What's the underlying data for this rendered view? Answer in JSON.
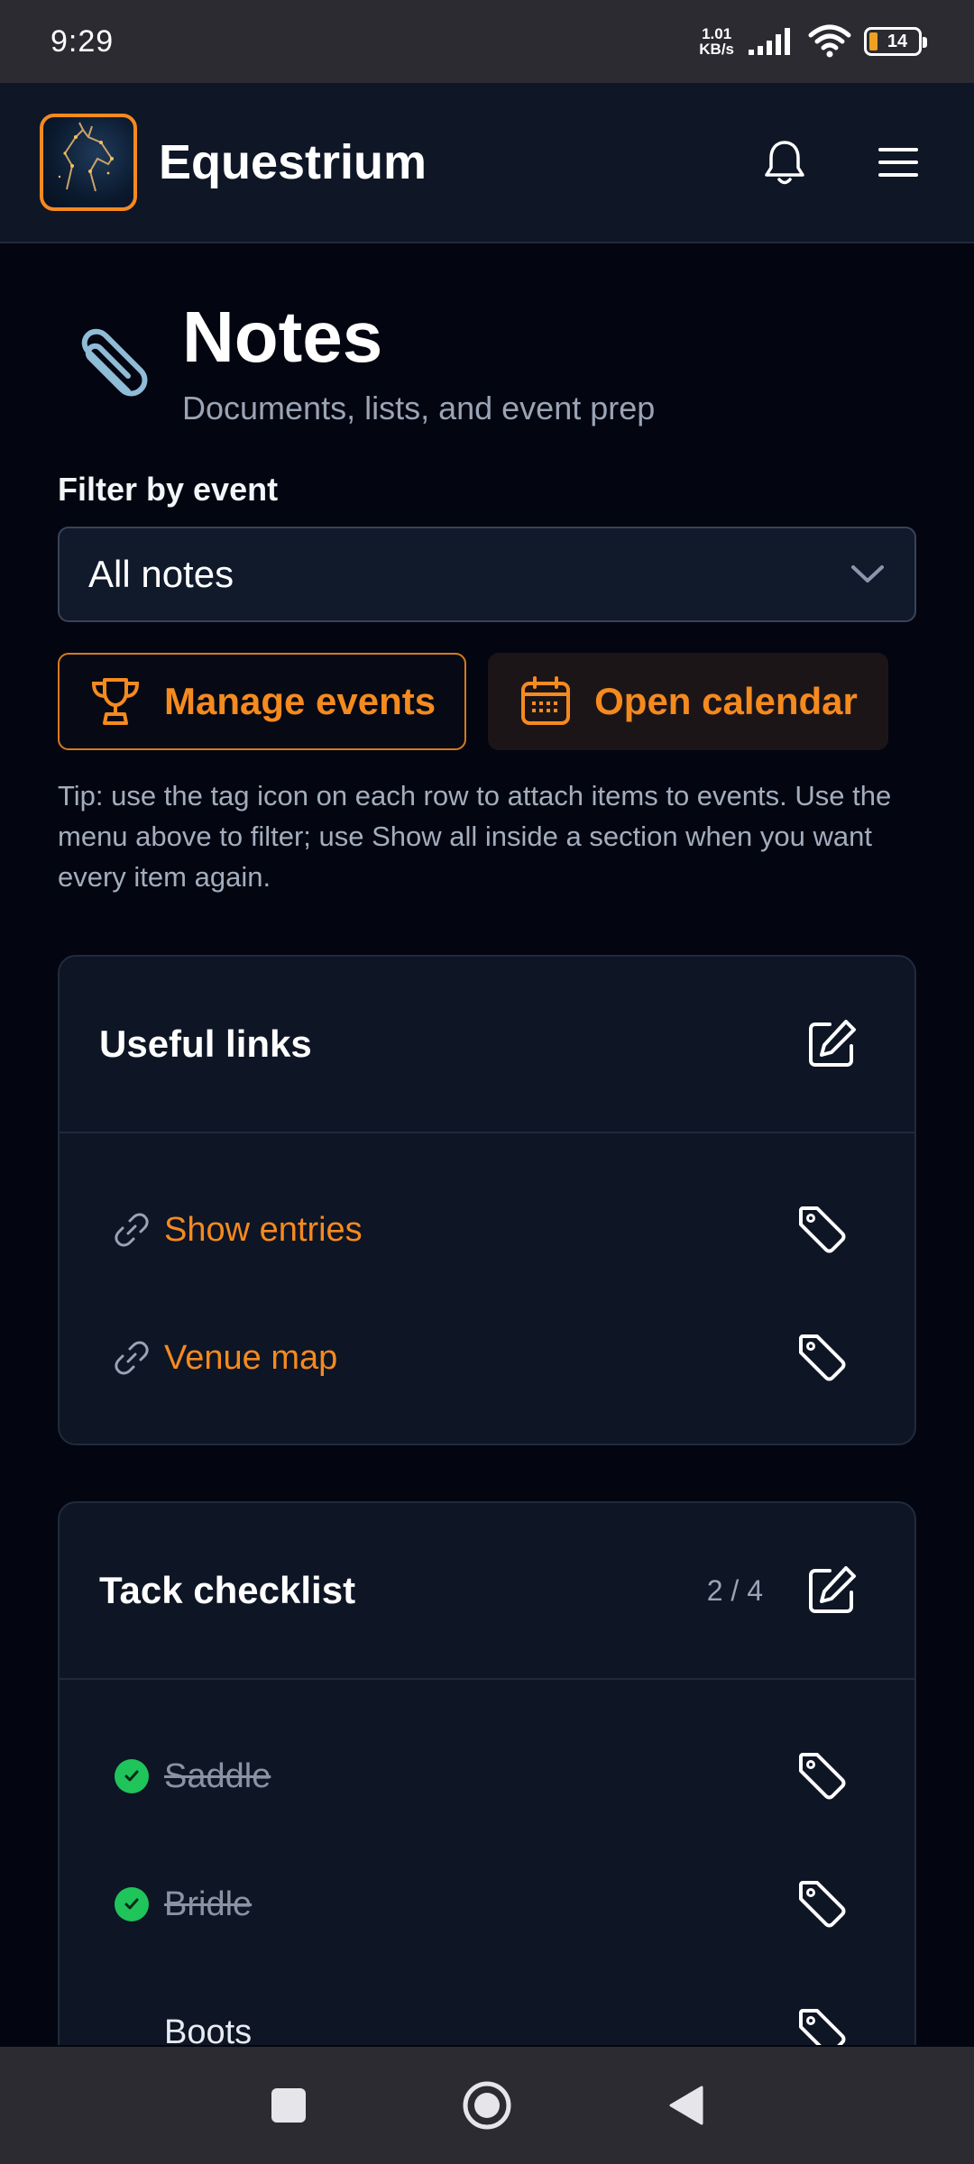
{
  "status_bar": {
    "time": "9:29",
    "net_speed_value": "1.01",
    "net_speed_unit": "KB/s",
    "battery": "14"
  },
  "app_bar": {
    "title": "Equestrium",
    "icons": [
      "bell-icon",
      "menu-icon"
    ]
  },
  "page": {
    "title": "Notes",
    "subtitle": "Documents, lists, and event prep"
  },
  "filter": {
    "label": "Filter by event",
    "selected": "All notes"
  },
  "actions": {
    "manage_events": "Manage events",
    "open_calendar": "Open calendar"
  },
  "tip": "Tip: use the tag icon on each row to attach items to events. Use the menu above to filter; use Show all inside a section when you want every item again.",
  "sections": {
    "useful_links": {
      "title": "Useful links",
      "items": [
        {
          "label": "Show entries"
        },
        {
          "label": "Venue map"
        }
      ]
    },
    "tack_checklist": {
      "title": "Tack checklist",
      "count": "2 / 4",
      "items": [
        {
          "label": "Saddle",
          "done": true
        },
        {
          "label": "Bridle",
          "done": true
        },
        {
          "label": "Boots",
          "done": false
        }
      ]
    }
  },
  "colors": {
    "accent": "#f58a1f",
    "background": "#030510",
    "card": "#0e1525",
    "check": "#1fc45a"
  }
}
